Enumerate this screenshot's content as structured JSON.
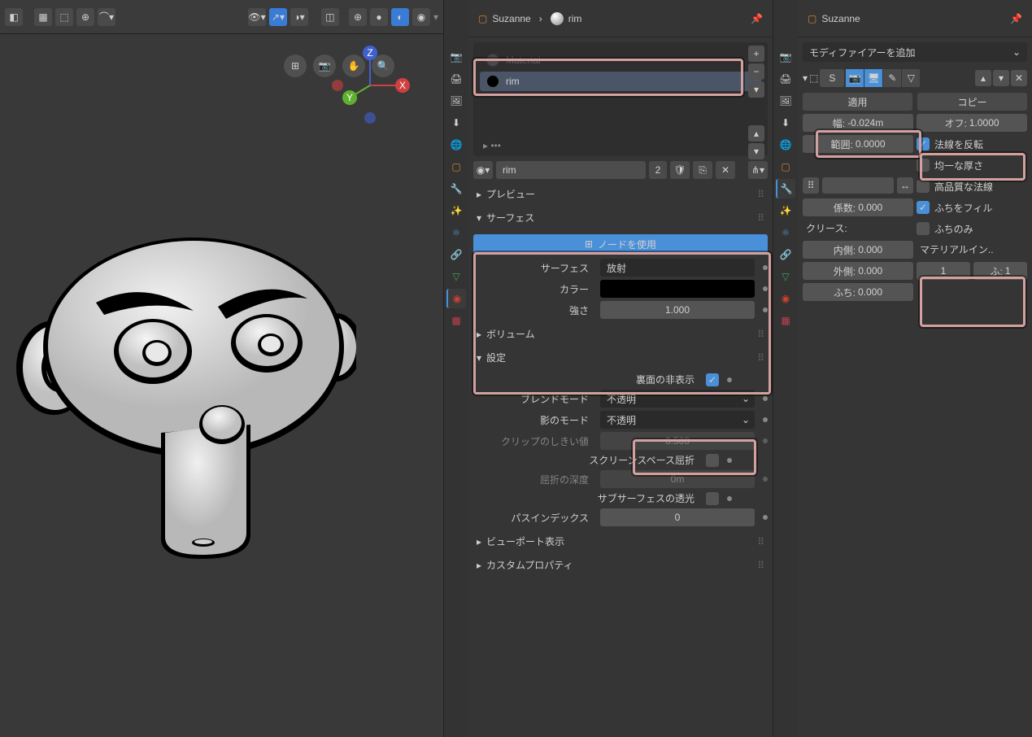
{
  "viewport": {
    "object_name": "Suzanne",
    "material_name": "rim"
  },
  "material_panel": {
    "breadcrumb_obj": "Suzanne",
    "breadcrumb_mat": "rim",
    "slot_material_top": "Material",
    "slot_rim": "rim",
    "material_name": "rim",
    "user_count": "2",
    "sections": {
      "preview": "プレビュー",
      "surface": "サーフェス",
      "volume": "ボリューム",
      "settings": "設定",
      "viewport_display": "ビューポート表示",
      "custom_props": "カスタムプロパティ"
    },
    "use_nodes": "ノードを使用",
    "surface_label": "サーフェス",
    "surface_val": "放射",
    "color_label": "カラー",
    "strength_label": "強さ",
    "strength_val": "1.000",
    "backface_label": "裏面の非表示",
    "blend_label": "ブレンドモード",
    "blend_val": "不透明",
    "shadow_label": "影のモード",
    "shadow_val": "不透明",
    "clip_label": "クリップのしきい値",
    "clip_val": "0.500",
    "ssr_label": "スクリーンスペース屈折",
    "refr_depth_label": "屈折の深度",
    "refr_depth_val": "0m",
    "sss_label": "サブサーフェスの透光",
    "pass_label": "パスインデックス",
    "pass_val": "0"
  },
  "modifier_panel": {
    "breadcrumb": "Suzanne",
    "add_modifier": "モディファイアーを追加",
    "mod_name": "S",
    "apply": "適用",
    "copy": "コピー",
    "width_label": "幅:",
    "width_val": "-0.024m",
    "offset_label": "オフ:",
    "offset_val": "1.0000",
    "range_label": "範囲:",
    "range_val": "0.0000",
    "flip_normals": "法線を反転",
    "even_thickness": "均一な厚さ",
    "hq_normals": "高品質な法線",
    "factor_label": "係数:",
    "factor_val": "0.000",
    "crease_label": "クリース:",
    "fill_rim": "ふちをフィル",
    "rim_only": "ふちのみ",
    "inner_label": "内側:",
    "inner_val": "0.000",
    "outer_label": "外側:",
    "outer_val": "0.000",
    "rim_label": "ふち:",
    "rim_val": "0.000",
    "mat_index_label": "マテリアルイン..",
    "mat_idx1": "1",
    "mat_idx2_label": "ふ:",
    "mat_idx2": "1"
  }
}
